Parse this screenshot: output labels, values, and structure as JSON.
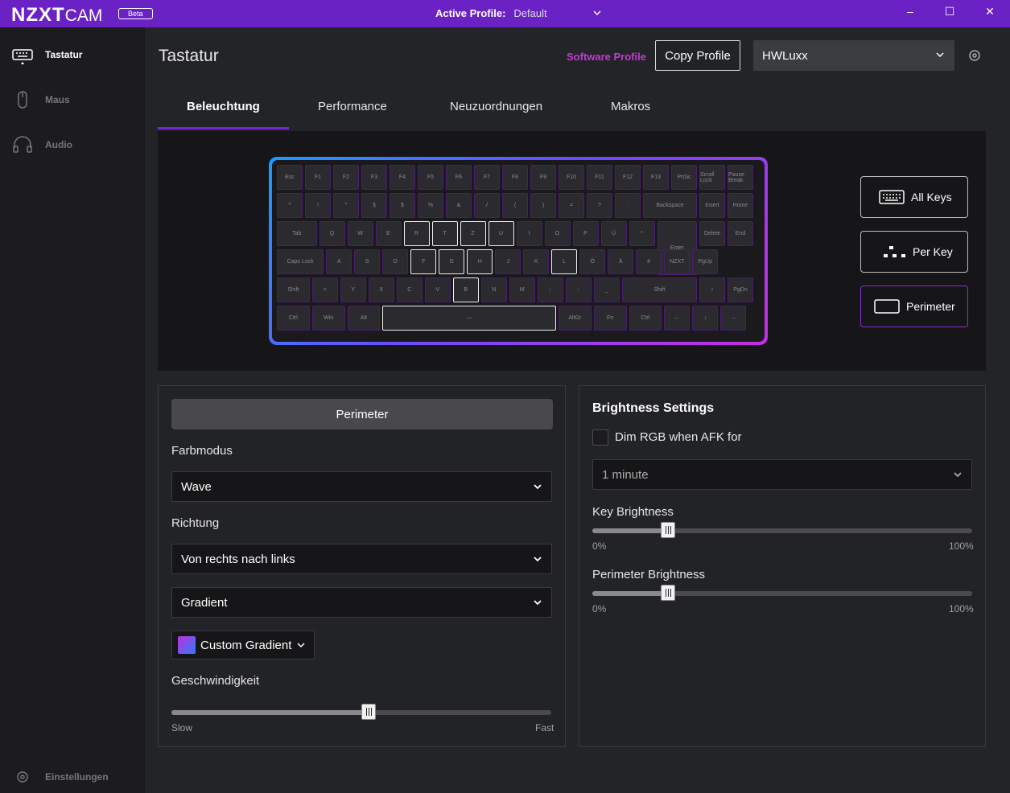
{
  "titlebar": {
    "logo": "NZXT",
    "logo_cam": "CAM",
    "badge": "Beta",
    "active_profile_label": "Active Profile:",
    "active_profile_value": "Default",
    "minimize": "–",
    "maximize": "☐",
    "close": "✕"
  },
  "sidebar": {
    "items": [
      {
        "label": "Tastatur",
        "active": true
      },
      {
        "label": "Maus",
        "active": false
      },
      {
        "label": "Audio",
        "active": false
      }
    ],
    "settings_label": "Einstellungen"
  },
  "header": {
    "title": "Tastatur",
    "software_profile": "Software Profile",
    "copy_profile": "Copy Profile",
    "profile_select": "HWLuxx"
  },
  "tabs": [
    "Beleuchtung",
    "Performance",
    "Neuzuordnungen",
    "Makros"
  ],
  "modes": {
    "all_keys": "All Keys",
    "per_key": "Per Key",
    "perimeter": "Perimeter"
  },
  "keyboard": {
    "rows": [
      [
        "Esc",
        "F1",
        "F2",
        "F3",
        "F4",
        "F5",
        "F6",
        "F7",
        "F8",
        "F9",
        "F10",
        "F11",
        "F12",
        "F13",
        "PrtSc",
        "Scroll Lock",
        "Pause Break"
      ],
      [
        "^",
        "!",
        "\"",
        "§",
        "$",
        "%",
        "&",
        "/",
        "(",
        ")",
        "=",
        "?",
        "`",
        "Backspace",
        "Insert",
        "Home"
      ],
      [
        "Tab",
        "Q",
        "W",
        "E",
        "R",
        "T",
        "Z",
        "U",
        "I",
        "O",
        "P",
        "Ü",
        "*",
        "Enter",
        "Delete",
        "End"
      ],
      [
        "Caps Lock",
        "A",
        "S",
        "D",
        "F",
        "G",
        "H",
        "J",
        "K",
        "L",
        "Ö",
        "Ä",
        "#",
        "NZXT",
        "PgUp"
      ],
      [
        "Shift",
        "<",
        "Y",
        "X",
        "C",
        "V",
        "B",
        "N",
        "M",
        ";",
        ":",
        "_",
        "Shift",
        "↑",
        "PgDn"
      ],
      [
        "Ctrl",
        "Win",
        "Alt",
        "—",
        "AltGr",
        "Fn",
        "Ctrl",
        "←",
        "↓",
        "→"
      ]
    ],
    "selected": [
      "R",
      "T",
      "Z",
      "U",
      "F",
      "G",
      "H",
      "L",
      "B",
      "—"
    ]
  },
  "left_panel": {
    "segment": "Perimeter",
    "color_mode_label": "Farbmodus",
    "color_mode_value": "Wave",
    "direction_label": "Richtung",
    "direction_value": "Von rechts nach links",
    "style_value": "Gradient",
    "custom_gradient": "Custom Gradient",
    "speed_label": "Geschwindigkeit",
    "speed_value": 0.52,
    "speed_min": "Slow",
    "speed_max": "Fast"
  },
  "right_panel": {
    "title": "Brightness Settings",
    "dim_label": "Dim RGB when AFK for",
    "dim_checked": false,
    "afk_value": "1 minute",
    "key_brightness_label": "Key Brightness",
    "key_brightness_value": 0.2,
    "perimeter_brightness_label": "Perimeter Brightness",
    "perimeter_brightness_value": 0.2,
    "min": "0%",
    "max": "100%"
  },
  "colors": {
    "accent": "#6b22c4",
    "accent_pink": "#c13ad6"
  }
}
